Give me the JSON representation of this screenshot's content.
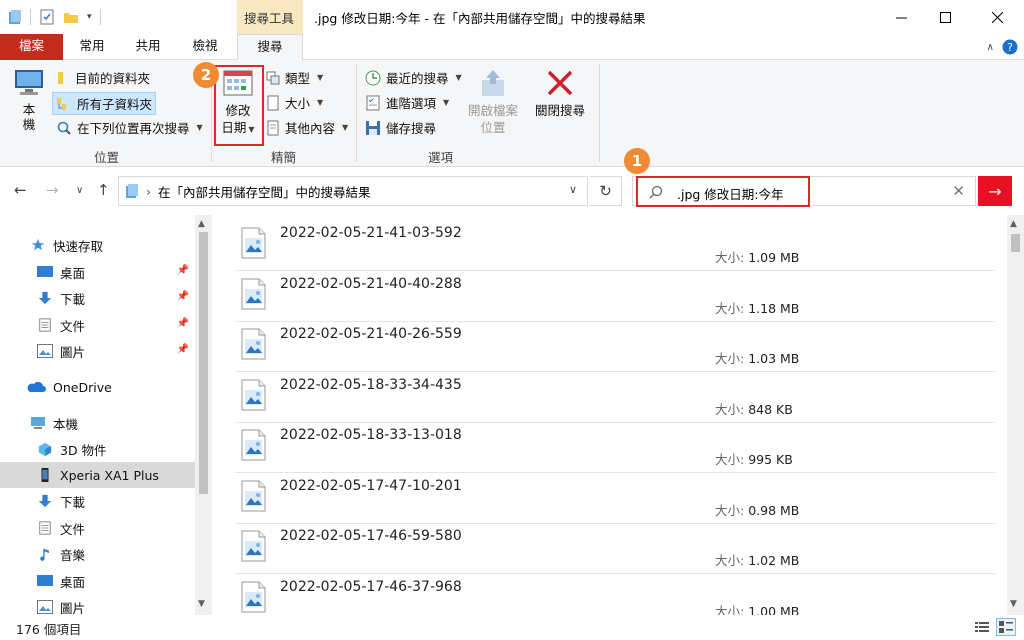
{
  "window": {
    "title": ".jpg 修改日期:今年 - 在「內部共用儲存空間」中的搜尋結果",
    "context_group": "搜尋工具"
  },
  "tabs": {
    "file": "檔案",
    "home": "常用",
    "share": "共用",
    "view": "檢視",
    "search": "搜尋"
  },
  "ribbon": {
    "location": {
      "label": "位置",
      "this_pc": "本\n機",
      "current_folder": "目前的資料夾",
      "all_subfolders": "所有子資料夾",
      "search_again": "在下列位置再次搜尋"
    },
    "refine": {
      "label": "精簡",
      "date_modified_1": "修改",
      "date_modified_2": "日期",
      "kind": "類型",
      "size": "大小",
      "other_properties": "其他內容"
    },
    "options": {
      "label": "選項",
      "recent_searches": "最近的搜尋",
      "advanced_options": "進階選項",
      "save_search": "儲存搜尋",
      "open_file_location_1": "開啟檔案",
      "open_file_location_2": "位置",
      "close_search": "關閉搜尋"
    }
  },
  "callouts": {
    "one": "1",
    "two": "2"
  },
  "address": {
    "path": "在「內部共用儲存空間」中的搜尋結果"
  },
  "search": {
    "value": ".jpg 修改日期:今年"
  },
  "nav": {
    "quick_access": "快速存取",
    "qa_desktop": "桌面",
    "qa_downloads": "下載",
    "qa_documents": "文件",
    "qa_pictures": "圖片",
    "onedrive": "OneDrive",
    "this_pc": "本機",
    "objects3d": "3D 物件",
    "device": "Xperia XA1 Plus",
    "downloads": "下載",
    "documents": "文件",
    "music": "音樂",
    "desktop": "桌面",
    "pictures": "圖片"
  },
  "files": [
    {
      "name": "2022-02-05-21-41-03-592",
      "size_label": "大小:",
      "size": "1.09 MB"
    },
    {
      "name": "2022-02-05-21-40-40-288",
      "size_label": "大小:",
      "size": "1.18 MB"
    },
    {
      "name": "2022-02-05-21-40-26-559",
      "size_label": "大小:",
      "size": "1.03 MB"
    },
    {
      "name": "2022-02-05-18-33-34-435",
      "size_label": "大小:",
      "size": "848 KB"
    },
    {
      "name": "2022-02-05-18-33-13-018",
      "size_label": "大小:",
      "size": "995 KB"
    },
    {
      "name": "2022-02-05-17-47-10-201",
      "size_label": "大小:",
      "size": "0.98 MB"
    },
    {
      "name": "2022-02-05-17-46-59-580",
      "size_label": "大小:",
      "size": "1.02 MB"
    },
    {
      "name": "2022-02-05-17-46-37-968",
      "size_label": "大小:",
      "size": "1.00 MB"
    }
  ],
  "status": {
    "count": "176 個項目"
  },
  "colors": {
    "accent": "#e0262b",
    "callout": "#f08a34",
    "file_tab": "#c42b1c",
    "context_group": "#f8e9c2"
  }
}
